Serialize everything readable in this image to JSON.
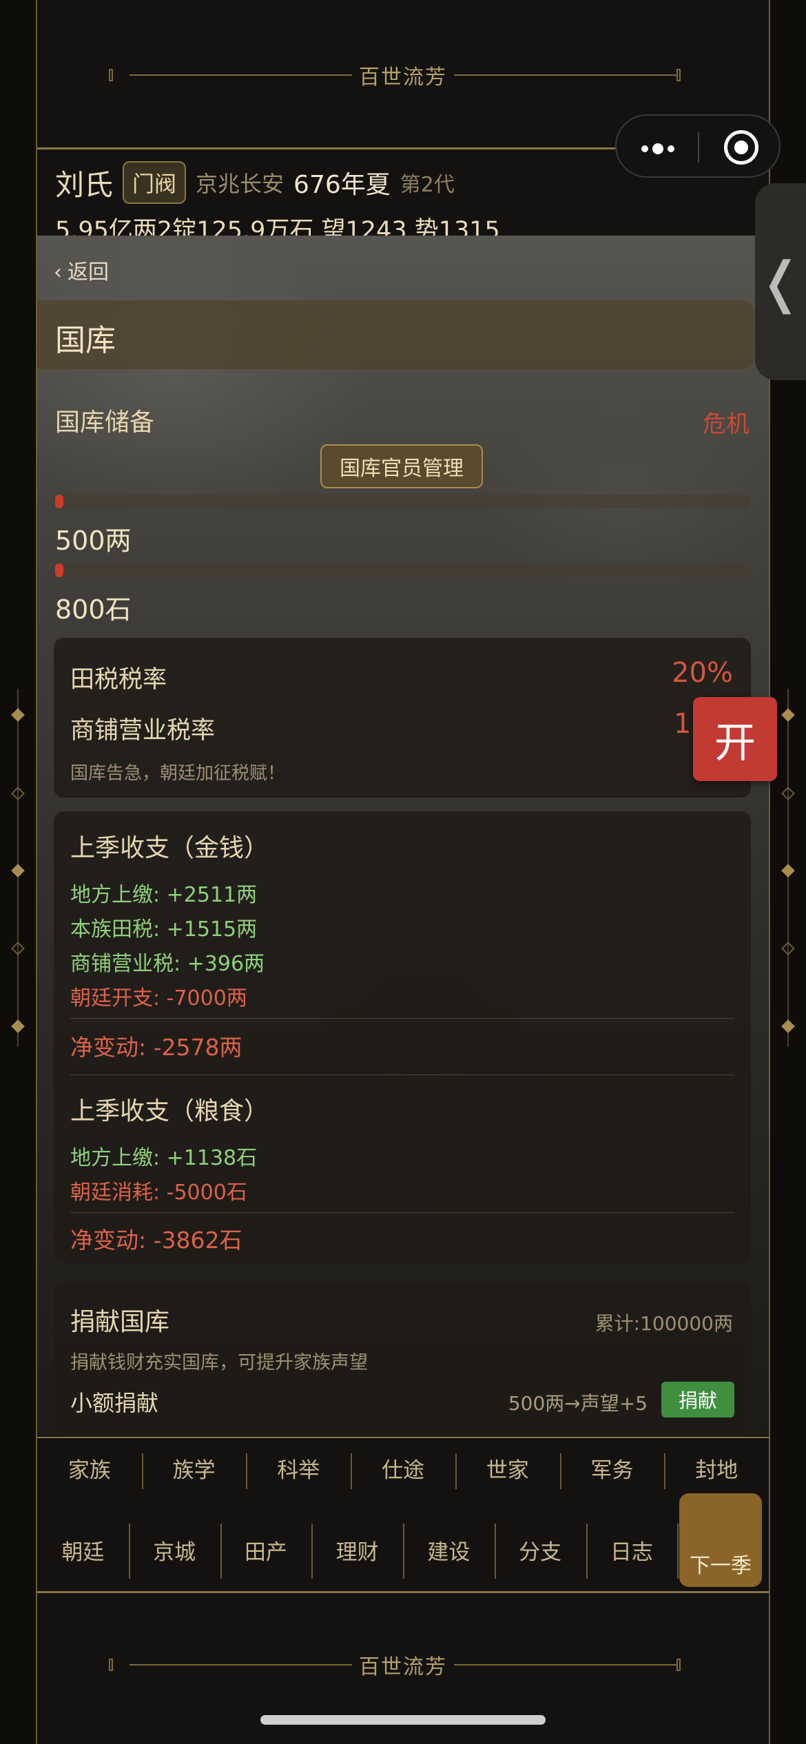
{
  "banner_title": "百世流芳",
  "status": {
    "family_name": "刘氏",
    "rank_badge": "门阀",
    "location": "京兆长安",
    "date": "676年夏",
    "generation": "第2代",
    "wealth_line": "5.95亿两2锭125.9万石  望1243 势1315"
  },
  "nav_back": "返回",
  "page_title": "国库",
  "treasury": {
    "label": "国库储备",
    "status": "危机",
    "manager_button": "国库官员管理",
    "money": {
      "amount": "500两",
      "fill": 0.003
    },
    "grain": {
      "amount": "800石",
      "fill": 0.006
    }
  },
  "tax": {
    "field_tax_label": "田税税率",
    "field_tax_value": "20%",
    "shop_tax_label": "商铺营业税率",
    "shop_tax_value": "1",
    "note": "国库告急，朝廷加征税赋！"
  },
  "open_button": "开",
  "money_ledger": {
    "title": "上季收支（金钱）",
    "lines": [
      {
        "text": "地方上缴: +2511两",
        "kind": "pos"
      },
      {
        "text": "本族田税: +1515两",
        "kind": "pos"
      },
      {
        "text": "商铺营业税: +396两",
        "kind": "pos"
      },
      {
        "text": "朝廷开支: -7000两",
        "kind": "neg"
      }
    ],
    "net": "净变动: -2578两"
  },
  "grain_ledger": {
    "title": "上季收支（粮食）",
    "lines": [
      {
        "text": "地方上缴: +1138石",
        "kind": "pos"
      },
      {
        "text": "朝廷消耗: -5000石",
        "kind": "neg"
      }
    ],
    "net": "净变动: -3862石"
  },
  "donation": {
    "title": "捐献国库",
    "total": "累计:100000两",
    "desc": "捐献钱财充实国库，可提升家族声望",
    "item": "小额捐献",
    "reward": "500两→声望+5",
    "button": "捐献"
  },
  "nav_row1": [
    "家族",
    "族学",
    "科举",
    "仕途",
    "世家",
    "军务",
    "封地"
  ],
  "nav_row2": [
    "朝廷",
    "京城",
    "田产",
    "理财",
    "建设",
    "分支",
    "日志"
  ],
  "next_season": "下一季",
  "colors": {
    "accent_gold": "#8a7444",
    "danger": "#c84a36",
    "positive": "#8fd07a",
    "negative": "#dc6148",
    "donate_green": "#3f8f3f"
  }
}
